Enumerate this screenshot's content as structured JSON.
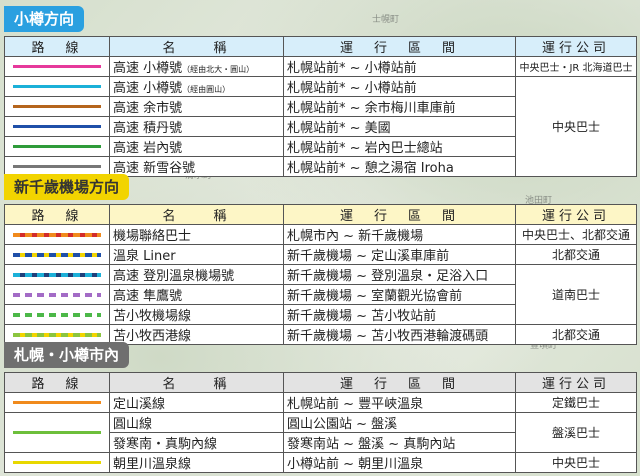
{
  "map_labels": [
    "士幌町",
    "清水町",
    "池田町",
    "豊頃町"
  ],
  "headers": {
    "route": "路　線",
    "name": "名　　稱",
    "section": "運　行　區　間",
    "operator": "運行公司"
  },
  "sections": [
    {
      "title": "小樽方向",
      "color": "#2aa0e0",
      "rows": [
        {
          "line_color": "#e6399b",
          "dashed": false,
          "name_main": "高速 小樽號",
          "name_sub": "（經由北大・圓山）",
          "section": "札幌站前* ~ 小樽站前",
          "operator": "中央巴士・JR 北海道巴士"
        },
        {
          "line_color": "#1bb0d8",
          "dashed": false,
          "name_main": "高速 小樽號",
          "name_sub": "（經由圓山）",
          "section": "札幌站前* ~ 小樽站前",
          "operator": ""
        },
        {
          "line_color": "#b5651d",
          "dashed": false,
          "name_main": "高速 余市號",
          "name_sub": "",
          "section": "札幌站前* ~ 余市梅川車庫前",
          "operator": ""
        },
        {
          "line_color": "#1f4fa8",
          "dashed": false,
          "name_main": "高速 積丹號",
          "name_sub": "",
          "section": "札幌站前* ~ 美國",
          "operator": "中央巴士"
        },
        {
          "line_color": "#2e9b3a",
          "dashed": false,
          "name_main": "高速 岩內號",
          "name_sub": "",
          "section": "札幌站前* ~ 岩內巴士總站",
          "operator": ""
        },
        {
          "line_color": "#777777",
          "dashed": false,
          "name_main": "高速 新雪谷號",
          "name_sub": "",
          "section": "札幌站前* ~ 憩之湯宿 Iroha",
          "operator": ""
        }
      ]
    },
    {
      "title": "新千歲機場方向",
      "color": "#f2d400",
      "rows": [
        {
          "line_color": "#f08a1c",
          "line_color2": "#d22b2b",
          "dashed": true,
          "name_main": "機場聯絡巴士",
          "name_sub": "",
          "section": "札幌市內 ~ 新千歲機場",
          "operator": "中央巴士、北都交通"
        },
        {
          "line_color": "#1f4fa8",
          "line_color2": "#f2d400",
          "dashed": true,
          "name_main": "溫泉 Liner",
          "name_sub": "",
          "section": "新千歲機場 ~ 定山溪車庫前",
          "operator": "北都交通"
        },
        {
          "line_color": "#1bb0d8",
          "line_color2": "#1f3f7a",
          "dashed": true,
          "name_main": "高速 登別溫泉機場號",
          "name_sub": "",
          "section": "新千歲機場 ~ 登別溫泉・足浴入口",
          "operator": ""
        },
        {
          "line_color": "#a36bc6",
          "line_color2": "#ffffff",
          "dashed": true,
          "name_main": "高速 隼鷹號",
          "name_sub": "",
          "section": "新千歲機場 ~ 室蘭觀光協會前",
          "operator": "道南巴士"
        },
        {
          "line_color": "#4cb848",
          "line_color2": "#ffffff",
          "dashed": true,
          "name_main": "苫小牧機場線",
          "name_sub": "",
          "section": "新千歲機場 ~ 苫小牧站前",
          "operator": ""
        },
        {
          "line_color": "#8bc53f",
          "line_color2": "#f2d400",
          "dashed": true,
          "name_main": "苫小牧西港線",
          "name_sub": "",
          "section": "新千歲機場 ~ 苫小牧西港輪渡碼頭",
          "operator": "北都交通"
        }
      ]
    },
    {
      "title": "札幌・小樽市內",
      "color": "#6f6f6f",
      "rows": [
        {
          "line_color": "#f08a1c",
          "dashed": false,
          "name_main": "定山溪線",
          "name_sub": "",
          "section": "札幌站前 ~ 豐平峽溫泉",
          "operator": "定鐵巴士"
        },
        {
          "line_color": "#6dbf3b",
          "dashed": false,
          "name_main": "圓山線",
          "name_sub": "",
          "section": "圓山公園站 ~ 盤溪",
          "operator": "盤溪巴士"
        },
        {
          "line_color": "",
          "dashed": false,
          "name_main": "發寒南・真駒內線",
          "name_sub": "",
          "section": "發寒南站 ~ 盤溪 ~ 真駒內站",
          "operator": ""
        },
        {
          "line_color": "#e8d800",
          "dashed": false,
          "name_main": "朝里川溫泉線",
          "name_sub": "",
          "section": "小樽站前 ~ 朝里川溫泉",
          "operator": "中央巴士"
        }
      ]
    }
  ]
}
